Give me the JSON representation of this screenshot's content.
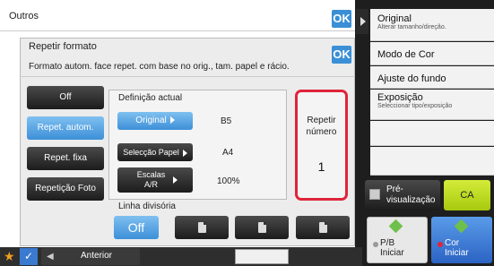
{
  "outer_dialog": {
    "title": "Outros",
    "ok": "OK"
  },
  "dialog": {
    "title": "Repetir formato",
    "ok": "OK",
    "description": "Formato autom. face repet. com base no orig., tam. papel e rácio.",
    "modes": [
      {
        "label": "Off",
        "selected": false
      },
      {
        "label": "Repet. autom.",
        "selected": true
      },
      {
        "label": "Repet. fixa",
        "selected": false
      },
      {
        "label": "Repetição Foto",
        "selected": false
      }
    ],
    "current": {
      "heading": "Definição actual",
      "original_label": "Original",
      "original_value": "B5",
      "paper_label": "Selecção Papel",
      "paper_value": "A4",
      "scale_label": "Escalas A/R",
      "scale_value": "100%"
    },
    "repeat": {
      "label": "Repetir número",
      "value": "1"
    },
    "dividing_line": {
      "heading": "Linha divisória",
      "off_label": "Off"
    }
  },
  "sidebar": [
    {
      "title": "Original",
      "subtitle": "Alterar tamanho/direção."
    },
    {
      "title": "Modo de Cor",
      "subtitle": ""
    },
    {
      "title": "Ajuste do fundo",
      "subtitle": ""
    },
    {
      "title": "Exposição",
      "subtitle": "Seleccionar tipo/exposição"
    }
  ],
  "bottom": {
    "preview": "Pré-visualização",
    "ca": "CA",
    "bw_start": "P/B Iniciar",
    "color_start": "Cor Iniciar",
    "back": "Anterior"
  },
  "colors": {
    "accent_blue": "#3a8fd6",
    "highlight_red": "#e0243a"
  }
}
